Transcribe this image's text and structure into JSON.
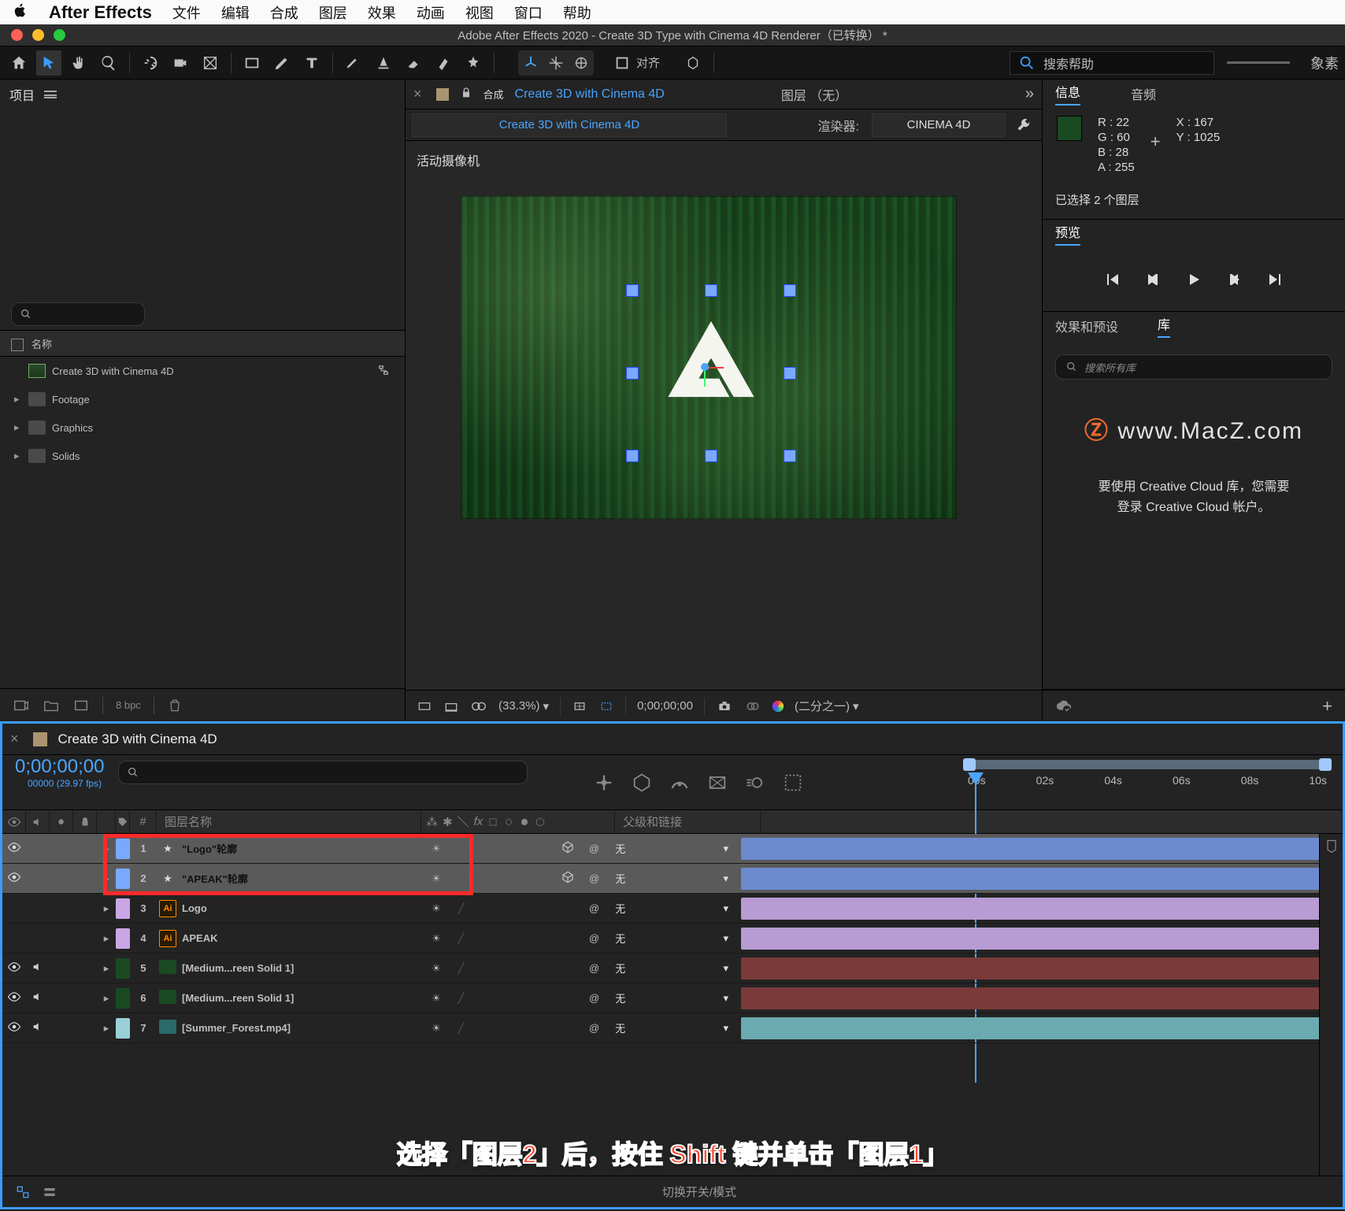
{
  "mac_menu": {
    "app": "After Effects",
    "items": [
      "文件",
      "编辑",
      "合成",
      "图层",
      "效果",
      "动画",
      "视图",
      "窗口",
      "帮助"
    ]
  },
  "window_title": "Adobe After Effects 2020 - Create 3D Type with Cinema 4D Renderer（已转换） *",
  "toolbar": {
    "align": "对齐",
    "search_help": "搜索帮助",
    "px": "象素"
  },
  "project": {
    "title": "项目",
    "col_name": "名称",
    "items": [
      {
        "name": "Create 3D with Cinema 4D",
        "type": "comp",
        "expand": false,
        "flow": true
      },
      {
        "name": "Footage",
        "type": "folder",
        "expand": true
      },
      {
        "name": "Graphics",
        "type": "folder",
        "expand": true
      },
      {
        "name": "Solids",
        "type": "folder",
        "expand": true
      }
    ],
    "bpc": "8 bpc"
  },
  "viewer": {
    "comp_prefix": "合成",
    "comp_name": "Create 3D with Cinema 4D",
    "layer_none": "图层 （无）",
    "render_label": "渲染器:",
    "renderer": "CINEMA 4D",
    "camera": "活动摄像机",
    "footer": {
      "pct": "(33.3%)",
      "tc": "0;00;00;00",
      "res": "(二分之一)"
    }
  },
  "info": {
    "tab1": "信息",
    "tab2": "音频",
    "r": "R :  22",
    "g": "G :  60",
    "b": "B :  28",
    "a": "A :  255",
    "x": "X : 167",
    "y": "Y : 1025",
    "sel": "已选择 2 个图层"
  },
  "preview": {
    "tab": "预览"
  },
  "fx": {
    "tab1": "效果和预设",
    "tab2": "库",
    "search_ph": "搜索所有库",
    "watermark": "www.MacZ.com",
    "cc1": "要使用 Creative Cloud 库，您需要",
    "cc2": "登录 Creative Cloud 帐户。"
  },
  "timeline": {
    "comp": "Create 3D with Cinema 4D",
    "tc": "0;00;00;00",
    "tc_sub": "00000 (29.97 fps)",
    "ruler": [
      "00s",
      "02s",
      "04s",
      "06s",
      "08s",
      "10s"
    ],
    "cols": {
      "num": "#",
      "name": "图层名称",
      "parent": "父级和链接"
    },
    "none": "无",
    "layers": [
      {
        "n": "1",
        "name": "\"Logo\"轮廓",
        "icon": "star",
        "chip": "#7aa8ff",
        "sel": true,
        "eye": true,
        "spk": false,
        "cube": true,
        "bar": "#6d8ad0",
        "sw": "sun"
      },
      {
        "n": "2",
        "name": "\"APEAK\"轮廓",
        "icon": "star",
        "chip": "#7aa8ff",
        "sel": true,
        "eye": true,
        "spk": false,
        "cube": true,
        "bar": "#6d8ad0",
        "sw": "sun"
      },
      {
        "n": "3",
        "name": "Logo",
        "icon": "ai",
        "chip": "#caa6e6",
        "sel": false,
        "eye": false,
        "spk": false,
        "cube": false,
        "bar": "#b79bd2",
        "sw": "sun"
      },
      {
        "n": "4",
        "name": "APEAK",
        "icon": "ai",
        "chip": "#caa6e6",
        "sel": false,
        "eye": false,
        "spk": false,
        "cube": false,
        "bar": "#b79bd2",
        "sw": "sun"
      },
      {
        "n": "5",
        "name": "[Medium...reen Solid 1]",
        "icon": "solid",
        "solid": "#1a4a22",
        "chip": "#1a4a22",
        "sel": false,
        "eye": true,
        "spk": true,
        "cube": false,
        "bar": "#7a3a3a",
        "sw": "sun"
      },
      {
        "n": "6",
        "name": "[Medium...reen Solid 1]",
        "icon": "solid",
        "solid": "#1a4a22",
        "chip": "#1a4a22",
        "sel": false,
        "eye": true,
        "spk": true,
        "cube": false,
        "bar": "#7a3a3a",
        "sw": "sun"
      },
      {
        "n": "7",
        "name": "[Summer_Forest.mp4]",
        "icon": "mov",
        "chip": "#9ad0d6",
        "sel": false,
        "eye": true,
        "spk": true,
        "cube": false,
        "bar": "#6aaab0",
        "sw": "sun"
      }
    ],
    "switch_label": "切换开关/模式"
  },
  "caption": "选择「图层2」后，按住 Shift 键并单击「图层1」"
}
